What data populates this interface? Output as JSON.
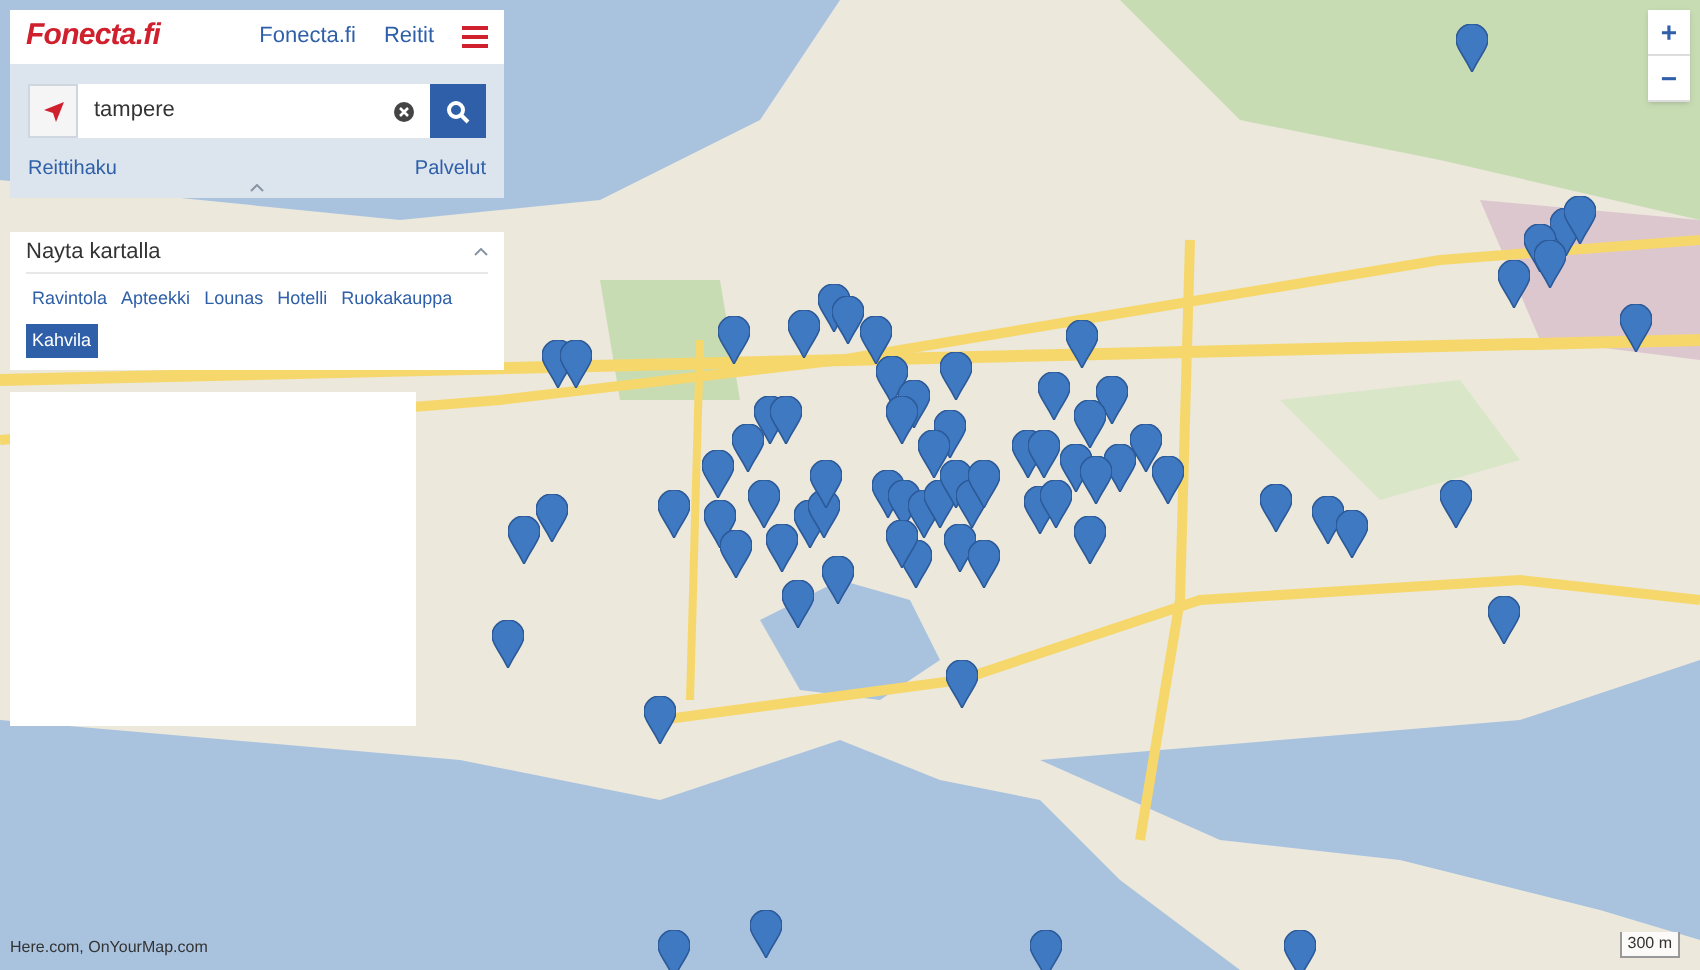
{
  "header": {
    "logo": "Fonecta.fi",
    "links": [
      "Fonecta.fi",
      "Reitit"
    ]
  },
  "search": {
    "value": "tampere"
  },
  "search_links": [
    "Reittihaku",
    "Palvelut"
  ],
  "categories_panel": {
    "title": "Nayta kartalla",
    "expanded": true,
    "items": [
      {
        "label": "Ravintola",
        "selected": false
      },
      {
        "label": "Apteekki",
        "selected": false
      },
      {
        "label": "Lounas",
        "selected": false
      },
      {
        "label": "Hotelli",
        "selected": false
      },
      {
        "label": "Ruokakauppa",
        "selected": false
      },
      {
        "label": "Kahvila",
        "selected": true
      }
    ]
  },
  "zoom_controls": [
    "+",
    "−"
  ],
  "attribution": "Here.com, OnYourMap.com",
  "scale": "300 m"
}
